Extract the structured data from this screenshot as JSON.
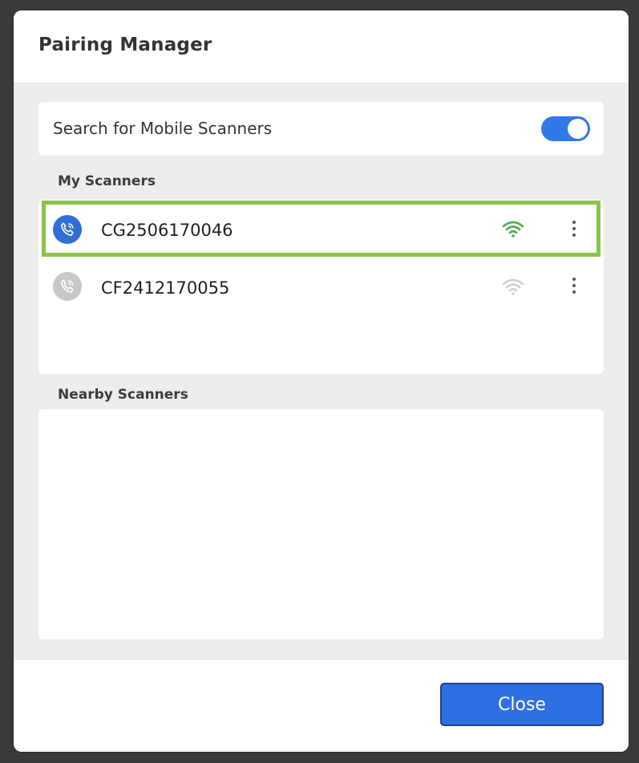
{
  "dialog": {
    "title": "Pairing Manager",
    "search": {
      "label": "Search for Mobile Scanners",
      "enabled": true
    },
    "my_scanners": {
      "label": "My Scanners",
      "items": [
        {
          "name": "CG2506170046",
          "status": "connected",
          "signal_icon": "wifi-icon",
          "signal_color": "#4caf50",
          "selected": true
        },
        {
          "name": "CF2412170055",
          "status": "disconnected",
          "signal_icon": "wifi-icon",
          "signal_color": "#c8c8c8",
          "selected": false
        }
      ]
    },
    "nearby_scanners": {
      "label": "Nearby Scanners",
      "items": []
    },
    "close_label": "Close"
  },
  "colors": {
    "accent": "#2f6fe4",
    "highlight": "#8bc34a",
    "connected_icon_bg": "#2f6fd6",
    "disconnected_icon_bg": "#c8c8c8"
  }
}
